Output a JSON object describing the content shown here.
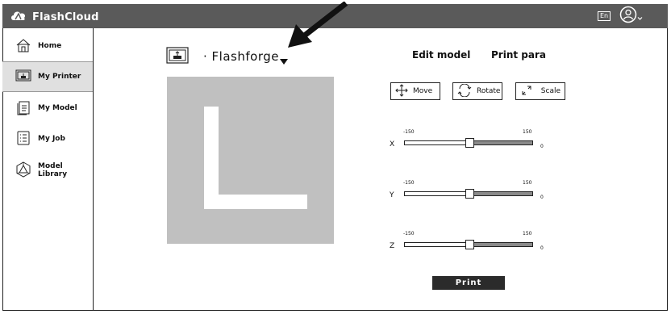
{
  "app": {
    "name": "FlashCloud",
    "language": "En"
  },
  "sidebar": {
    "items": [
      {
        "label": "Home",
        "icon": "home-icon",
        "active": false
      },
      {
        "label": "My Printer",
        "icon": "printer-icon",
        "active": true
      },
      {
        "label": "My Model",
        "icon": "model-file-icon",
        "active": false
      },
      {
        "label": "My Job",
        "icon": "job-list-icon",
        "active": false
      },
      {
        "label": "Model Library",
        "icon": "library-icon",
        "active": false
      }
    ]
  },
  "device": {
    "name": "Flashforge"
  },
  "tabs": {
    "edit": "Edit model",
    "print_para": "Print para"
  },
  "tools": {
    "move": "Move",
    "rotate": "Rotate",
    "scale": "Scale"
  },
  "axes": [
    {
      "label": "X",
      "min": "-150",
      "max": "150",
      "value": "0",
      "position": 0.5
    },
    {
      "label": "Y",
      "min": "-150",
      "max": "150",
      "value": "0",
      "position": 0.5
    },
    {
      "label": "Z",
      "min": "-150",
      "max": "150",
      "value": "0",
      "position": 0.5
    }
  ],
  "print_button": "Print",
  "colors": {
    "topbar": "#5a5a5a",
    "preview_bg": "#c0c0c0",
    "print_button": "#2b2b2b",
    "active_nav": "#e0e0e0"
  }
}
